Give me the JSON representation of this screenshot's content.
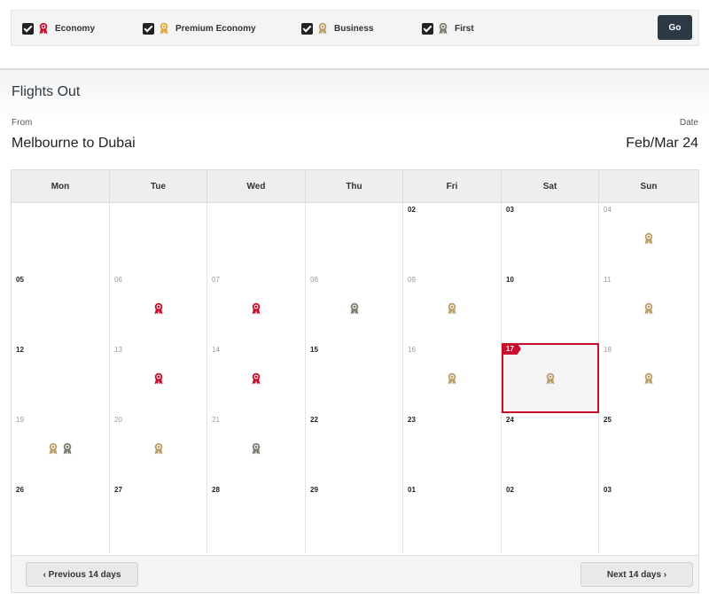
{
  "filters": [
    {
      "label": "Economy",
      "checked": true,
      "medal": "economy"
    },
    {
      "label": "Premium Economy",
      "checked": true,
      "medal": "premium"
    },
    {
      "label": "Business",
      "checked": true,
      "medal": "business"
    },
    {
      "label": "First",
      "checked": true,
      "medal": "first"
    }
  ],
  "go_label": "Go",
  "section_title": "Flights Out",
  "from_label": "From",
  "date_label": "Date",
  "route": "Melbourne to Dubai",
  "month": "Feb/Mar 24",
  "colors": {
    "economy": "#c8102e",
    "premium": "#e0a83a",
    "business": "#b9a06a",
    "first": "#7d7d70",
    "selected": "#c8102e"
  },
  "days": [
    "Mon",
    "Tue",
    "Wed",
    "Thu",
    "Fri",
    "Sat",
    "Sun"
  ],
  "weeks": [
    [
      {
        "num": "",
        "muted": false,
        "awards": []
      },
      {
        "num": "",
        "muted": false,
        "awards": []
      },
      {
        "num": "",
        "muted": false,
        "awards": []
      },
      {
        "num": "",
        "muted": false,
        "awards": []
      },
      {
        "num": "02",
        "muted": false,
        "awards": []
      },
      {
        "num": "03",
        "muted": false,
        "awards": []
      },
      {
        "num": "04",
        "muted": true,
        "awards": [
          "business"
        ]
      }
    ],
    [
      {
        "num": "05",
        "muted": false,
        "awards": []
      },
      {
        "num": "06",
        "muted": true,
        "awards": [
          "economy"
        ]
      },
      {
        "num": "07",
        "muted": true,
        "awards": [
          "economy"
        ]
      },
      {
        "num": "08",
        "muted": true,
        "awards": [
          "first"
        ]
      },
      {
        "num": "09",
        "muted": true,
        "awards": [
          "business"
        ]
      },
      {
        "num": "10",
        "muted": false,
        "awards": []
      },
      {
        "num": "11",
        "muted": true,
        "awards": [
          "business"
        ]
      }
    ],
    [
      {
        "num": "12",
        "muted": false,
        "awards": []
      },
      {
        "num": "13",
        "muted": true,
        "awards": [
          "economy"
        ]
      },
      {
        "num": "14",
        "muted": true,
        "awards": [
          "economy"
        ]
      },
      {
        "num": "15",
        "muted": false,
        "awards": []
      },
      {
        "num": "16",
        "muted": true,
        "awards": [
          "business"
        ]
      },
      {
        "num": "17",
        "muted": false,
        "selected": true,
        "awards": [
          "business"
        ]
      },
      {
        "num": "18",
        "muted": true,
        "awards": [
          "business"
        ]
      }
    ],
    [
      {
        "num": "19",
        "muted": true,
        "awards": [
          "business",
          "first"
        ]
      },
      {
        "num": "20",
        "muted": true,
        "awards": [
          "business"
        ]
      },
      {
        "num": "21",
        "muted": true,
        "awards": [
          "first"
        ]
      },
      {
        "num": "22",
        "muted": false,
        "awards": []
      },
      {
        "num": "23",
        "muted": false,
        "awards": []
      },
      {
        "num": "24",
        "muted": false,
        "awards": []
      },
      {
        "num": "25",
        "muted": false,
        "awards": []
      }
    ],
    [
      {
        "num": "26",
        "muted": false,
        "awards": []
      },
      {
        "num": "27",
        "muted": false,
        "awards": []
      },
      {
        "num": "28",
        "muted": false,
        "awards": []
      },
      {
        "num": "29",
        "muted": false,
        "awards": []
      },
      {
        "num": "01",
        "muted": false,
        "awards": []
      },
      {
        "num": "02",
        "muted": false,
        "awards": []
      },
      {
        "num": "03",
        "muted": false,
        "awards": []
      }
    ]
  ],
  "prev_label": "‹ Previous 14 days",
  "next_label": "Next 14 days ›"
}
